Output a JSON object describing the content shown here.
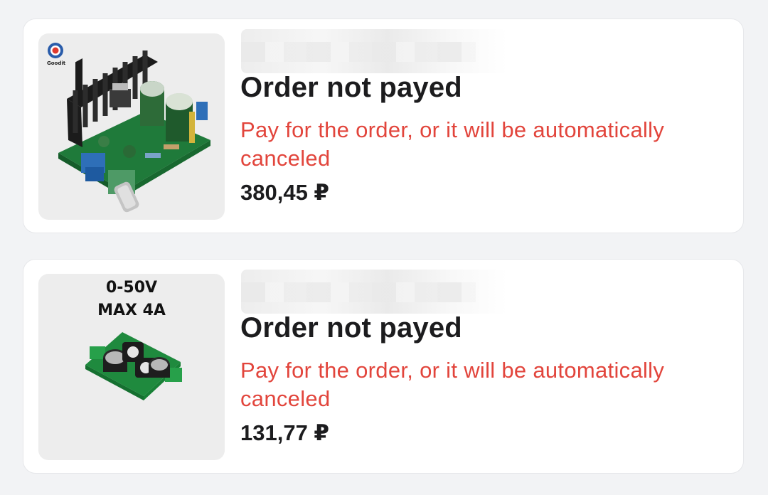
{
  "orders": [
    {
      "title": "Order not payed",
      "message": "Pay for the order, or it will be automatically canceled",
      "price": "380,45 ₽",
      "product_image": "amplifier-board-with-heatsink",
      "image_logo_text": "Goodit"
    },
    {
      "title": "Order not payed",
      "message": "Pay for the order, or it will be automatically canceled",
      "price": "131,77 ₽",
      "product_image": "power-filter-module",
      "image_label_line1": "0-50V",
      "image_label_line2": "MAX 4A"
    }
  ],
  "colors": {
    "background": "#f2f3f5",
    "card": "#ffffff",
    "title": "#1c1c1e",
    "warning": "#e2453c"
  }
}
